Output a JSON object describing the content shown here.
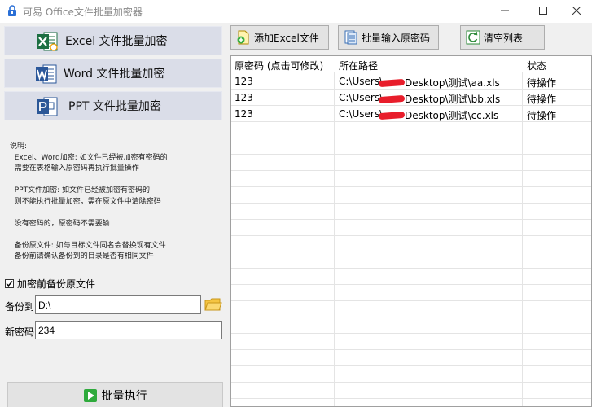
{
  "window": {
    "title": "可易 Office文件批量加密器",
    "controls": [
      "minimize-icon",
      "maximize-icon",
      "close-icon"
    ]
  },
  "left_panel": {
    "mode_buttons": [
      {
        "label": "Excel 文件批量加密",
        "icon": "excel-icon",
        "icon_color": "#1d6f42"
      },
      {
        "label": "Word 文件批量加密",
        "icon": "word-icon",
        "icon_color": "#2b579a"
      },
      {
        "label": "PPT 文件批量加密",
        "icon": "powerpoint-icon",
        "icon_color": "#2b5797"
      }
    ],
    "notes": "说明:\n  Excel、Word加密: 如文件已经被加密有密码的\n  需要在表格输入原密码再执行批量操作\n\n  PPT文件加密: 如文件已经被加密有密码的\n  则不能执行批量加密，需在原文件中清除密码\n\n  没有密码的，原密码不需要输\n\n  备份原文件: 如与目标文件同名会替换现有文件\n  备份前请确认备份到的目录是否有相同文件",
    "backup_checkbox": {
      "label": "加密前备份原文件",
      "checked": true
    },
    "backup_to": {
      "label": "备份到",
      "value": "D:\\"
    },
    "new_password": {
      "label": "新密码",
      "value": "234"
    },
    "run_button": {
      "label": "批量执行",
      "icon": "play-icon"
    }
  },
  "toolbar": {
    "add_excel": {
      "label": "添加Excel文件",
      "icon": "add-file-icon"
    },
    "batch_password": {
      "label": "批量输入原密码",
      "icon": "document-list-icon"
    },
    "clear_list": {
      "label": "清空列表",
      "icon": "refresh-icon"
    }
  },
  "grid": {
    "columns": [
      "原密码 (点击可修改)",
      "所在路径",
      "状态"
    ],
    "rows": [
      {
        "password": "123",
        "path": "C:\\Users\\",
        "path_tail": "Desktop\\测试\\aa.xls",
        "status": "待操作"
      },
      {
        "password": "123",
        "path": "C:\\Users\\",
        "path_tail": "Desktop\\测试\\bb.xls",
        "status": "待操作"
      },
      {
        "password": "123",
        "path": "C:\\Users\\",
        "path_tail": "Desktop\\测试\\cc.xls",
        "status": "待操作"
      }
    ]
  },
  "colors": {
    "mode_button_bg": "#dadde8",
    "redaction": "#e81d2b",
    "run_icon": "#2eaa3c"
  }
}
